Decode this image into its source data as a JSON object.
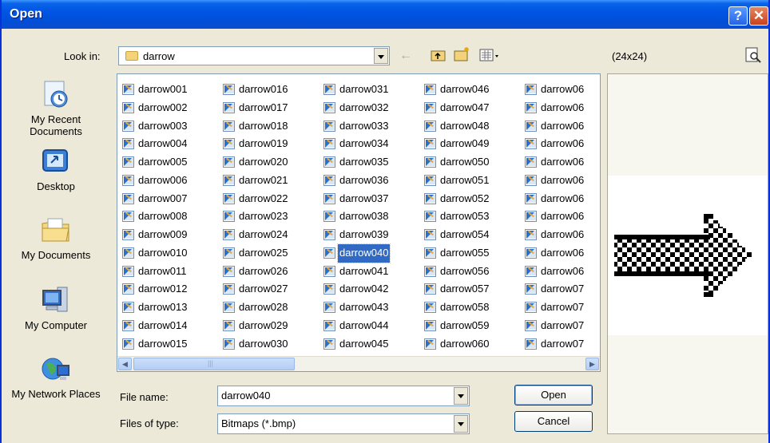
{
  "window": {
    "title": "Open"
  },
  "lookin": {
    "label": "Look in:",
    "value": "darrow"
  },
  "preview": {
    "size_label": "(24x24)"
  },
  "places": [
    {
      "label": "My Recent Documents",
      "icon": "recent-documents-icon"
    },
    {
      "label": "Desktop",
      "icon": "desktop-icon"
    },
    {
      "label": "My Documents",
      "icon": "my-documents-icon"
    },
    {
      "label": "My Computer",
      "icon": "my-computer-icon"
    },
    {
      "label": "My Network Places",
      "icon": "network-places-icon"
    }
  ],
  "files": {
    "columns": [
      [
        "darrow001",
        "darrow002",
        "darrow003",
        "darrow004",
        "darrow005",
        "darrow006",
        "darrow007",
        "darrow008",
        "darrow009",
        "darrow010",
        "darrow011",
        "darrow012",
        "darrow013",
        "darrow014",
        "darrow015"
      ],
      [
        "darrow016",
        "darrow017",
        "darrow018",
        "darrow019",
        "darrow020",
        "darrow021",
        "darrow022",
        "darrow023",
        "darrow024",
        "darrow025",
        "darrow026",
        "darrow027",
        "darrow028",
        "darrow029",
        "darrow030"
      ],
      [
        "darrow031",
        "darrow032",
        "darrow033",
        "darrow034",
        "darrow035",
        "darrow036",
        "darrow037",
        "darrow038",
        "darrow039",
        "darrow040",
        "darrow041",
        "darrow042",
        "darrow043",
        "darrow044",
        "darrow045"
      ],
      [
        "darrow046",
        "darrow047",
        "darrow048",
        "darrow049",
        "darrow050",
        "darrow051",
        "darrow052",
        "darrow053",
        "darrow054",
        "darrow055",
        "darrow056",
        "darrow057",
        "darrow058",
        "darrow059",
        "darrow060"
      ],
      [
        "darrow06",
        "darrow06",
        "darrow06",
        "darrow06",
        "darrow06",
        "darrow06",
        "darrow06",
        "darrow06",
        "darrow06",
        "darrow06",
        "darrow06",
        "darrow07",
        "darrow07",
        "darrow07",
        "darrow07"
      ]
    ],
    "selected": "darrow040"
  },
  "filename": {
    "label": "File name:",
    "value": "darrow040"
  },
  "filetype": {
    "label": "Files of type:",
    "value": "Bitmaps (*.bmp)"
  },
  "buttons": {
    "open": "Open",
    "cancel": "Cancel"
  },
  "colors": {
    "titlebar": "#0055e5",
    "selection": "#316ac5"
  }
}
